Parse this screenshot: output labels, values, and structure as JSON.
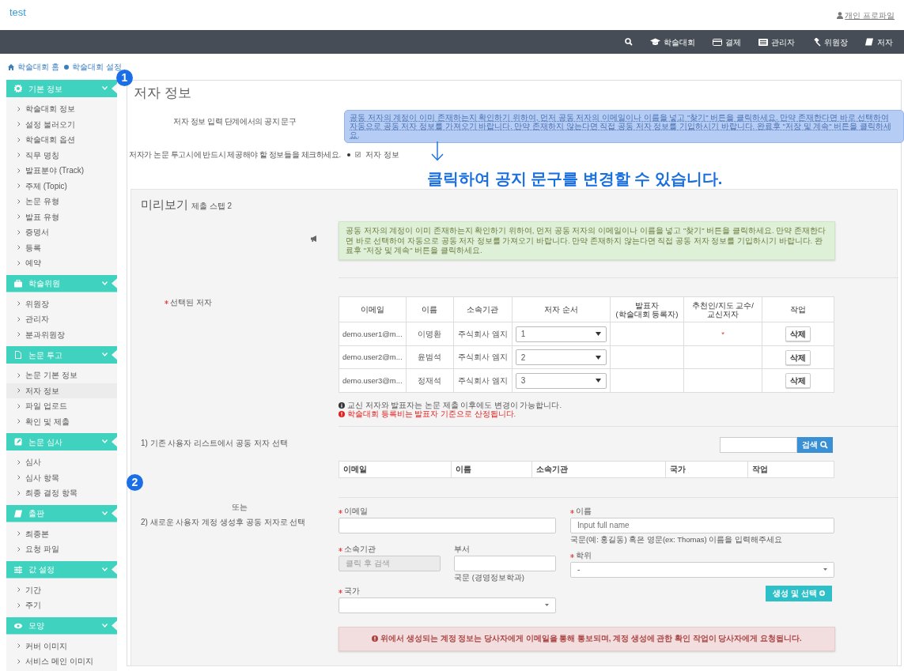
{
  "header": {
    "brand": "test",
    "profile": "개인 프로파일"
  },
  "navbar": {
    "items": [
      {
        "label": "학술대회"
      },
      {
        "label": "결제"
      },
      {
        "label": "관리자"
      },
      {
        "label": "위원장"
      },
      {
        "label": "저자"
      }
    ]
  },
  "breadcrumb": [
    "학술대회 홈",
    "학술대회 설정"
  ],
  "sidebar": {
    "sections": [
      {
        "title": "기본 정보",
        "expanded": true,
        "items": [
          {
            "label": "학술대회 정보",
            "selected": false
          },
          {
            "label": "설정 불러오기",
            "selected": false
          },
          {
            "label": "학술대회 옵션",
            "selected": false
          },
          {
            "label": "직무 명칭",
            "selected": false
          },
          {
            "label": "발표분야 (Track)",
            "selected": false
          },
          {
            "label": "주제 (Topic)",
            "selected": false
          },
          {
            "label": "논문 유형",
            "selected": false
          },
          {
            "label": "발표 유형",
            "selected": false
          },
          {
            "label": "증명서",
            "selected": false
          },
          {
            "label": "등록",
            "selected": false
          },
          {
            "label": "예약",
            "selected": false
          }
        ]
      },
      {
        "title": "학술위원",
        "expanded": true,
        "items": [
          {
            "label": "위원장",
            "selected": false
          },
          {
            "label": "관리자",
            "selected": false
          },
          {
            "label": "분과위원장",
            "selected": false
          }
        ]
      },
      {
        "title": "논문 투고",
        "expanded": true,
        "items": [
          {
            "label": "논문 기본 정보",
            "selected": false
          },
          {
            "label": "저자 정보",
            "selected": true
          },
          {
            "label": "파일 업로드",
            "selected": false
          },
          {
            "label": "확인 및 제출",
            "selected": false
          }
        ]
      },
      {
        "title": "논문 심사",
        "expanded": true,
        "items": [
          {
            "label": "심사",
            "selected": false
          },
          {
            "label": "심사 항목",
            "selected": false
          },
          {
            "label": "최종 결정 항목",
            "selected": false
          }
        ]
      },
      {
        "title": "출판",
        "expanded": true,
        "items": [
          {
            "label": "최종본",
            "selected": false
          },
          {
            "label": "요청 파일",
            "selected": false
          }
        ]
      },
      {
        "title": "값 설정",
        "expanded": true,
        "items": [
          {
            "label": "기간",
            "selected": false
          },
          {
            "label": "주기",
            "selected": false
          }
        ]
      },
      {
        "title": "모양",
        "expanded": true,
        "items": [
          {
            "label": "커버 이미지",
            "selected": false
          },
          {
            "label": "서비스 메인 이미지",
            "selected": false
          }
        ]
      }
    ]
  },
  "annotations": {
    "markers": [
      "1",
      "2"
    ],
    "callout": "클릭하여 공지 문구를 변경할 수 있습니다."
  },
  "page": {
    "title": "저자 정보",
    "notice": {
      "label": "저자 정보 입력 단계에서의 공지 문구",
      "text": "공동 저자의 계정이 이미 존재하는지 확인하기 위하여, 먼저 공동 저자의 이메일이나 이름을 넣고 \"찾기\" 버튼을 클릭하세요. 만약 존재한다면 바로 선택하여 자동으로 공동 저자 정보를 가져오기 바랍니다. 만약 존재하지 않는다면 직접 공동 저자 정보를 기입하시기 바랍니다. 완료후 \"저장 및 계속\" 버튼을 클릭하세요."
    },
    "required_info": {
      "label": "저자가 논문 투고시에 반드시 제공해야 할 정보들을 체크하세요.",
      "options": [
        {
          "label": "저자 정보",
          "checked": true
        }
      ]
    }
  },
  "preview": {
    "title": "미리보기",
    "subtitle": "제출 스텝 2",
    "alert": "공동 저자의 계정이 이미 존재하는지 확인하기 위하여, 먼저 공동 저자의 이메일이나 이름을 넣고 \"찾기\" 버튼을 클릭하세요. 만약 존재한다면 바로 선택하여 자동으로 공동 저자 정보를 가져오기 바랍니다. 만약 존재하지 않는다면 직접 공동 저자 정보를 기입하시기 바랍니다. 완료후 \"저장 및 계속\" 버튼을 클릭하세요.",
    "selected_authors": {
      "label": "선택된 저자",
      "required": true,
      "columns": [
        "이메일",
        "이름",
        "소속기관",
        "저자 순서",
        "발표자\n(학술대회 등록자)",
        "추천인/지도 교수/\n교신저자",
        "작업"
      ],
      "rows": [
        {
          "email": "demo.user1@m...",
          "name": "이명환",
          "affiliation": "주식회사 엠지",
          "order": "1",
          "presenter": "",
          "corresponding": "*",
          "action": "삭제"
        },
        {
          "email": "demo.user2@m...",
          "name": "윤범석",
          "affiliation": "주식회사 엠지",
          "order": "2",
          "presenter": "",
          "corresponding": "",
          "action": "삭제"
        },
        {
          "email": "demo.user3@m...",
          "name": "정재석",
          "affiliation": "주식회사 엠지",
          "order": "3",
          "presenter": "",
          "corresponding": "",
          "action": "삭제"
        }
      ]
    },
    "notes": [
      {
        "kind": "info",
        "text": "교신 저자와 발표자는 논문 제출 이후에도 변경이 가능합니다."
      },
      {
        "kind": "error",
        "text": "학술대회 등록비는 발표자 기준으로 산정됩니다."
      }
    ],
    "existing": {
      "label": "1) 기존 사용자 리스트에서 공동 저자 선택",
      "search_button": "검색",
      "columns": [
        "이메일",
        "이름",
        "소속기관",
        "국가",
        "작업"
      ]
    },
    "or_text": "또는",
    "new_user": {
      "label": "2) 새로운 사용자 계정 생성후 공동 저자로 선택",
      "fields": [
        {
          "kind": "input",
          "label": "이메일",
          "required": true
        },
        {
          "kind": "input",
          "label": "이름",
          "required": true,
          "placeholder": "Input full name",
          "help": "국문(예: 홍길동) 혹은 영문(ex: Thomas) 이름을 입력해주세요"
        },
        {
          "kind": "disabled",
          "label": "소속기관",
          "required": true,
          "value": "클릭 후 검색"
        },
        {
          "kind": "input",
          "label": "부서",
          "required": false,
          "help": "국문 (경영정보학과)"
        },
        {
          "kind": "select",
          "label": "학위",
          "required": true,
          "value": "-"
        },
        {
          "kind": "select",
          "label": "국가",
          "required": true
        }
      ],
      "create_button": "생성 및 선택"
    },
    "warning": "위에서 생성되는 계정 정보는 당사자에게 이메일을 통해 통보되며, 계정 생성에 관한 확인 작업이 당사자에게 요청됩니다."
  }
}
